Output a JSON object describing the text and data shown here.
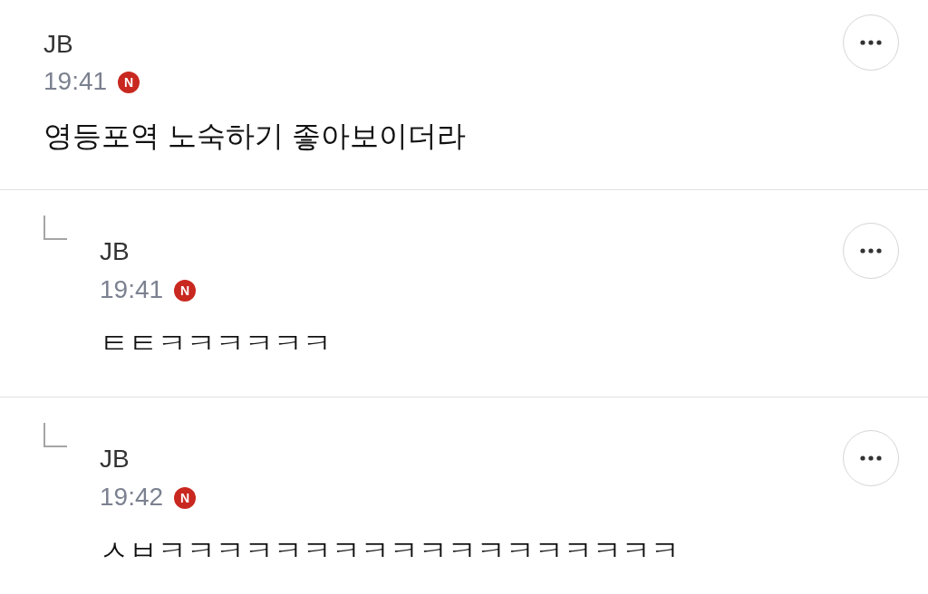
{
  "comments": [
    {
      "kind": "comment",
      "author": "JB",
      "time": "19:41",
      "badge": "N",
      "text": "영등포역 노숙하기 좋아보이더라"
    },
    {
      "kind": "reply",
      "author": "JB",
      "time": "19:41",
      "badge": "N",
      "text": "ㅌㅌㅋㅋㅋㅋㅋㅋ"
    },
    {
      "kind": "reply",
      "author": "JB",
      "time": "19:42",
      "badge": "N",
      "text": "ㅅㅂㅋㅋㅋㅋㅋㅋㅋㅋㅋㅋㅋㅋㅋㅋㅋㅋㅋㅋ"
    }
  ]
}
